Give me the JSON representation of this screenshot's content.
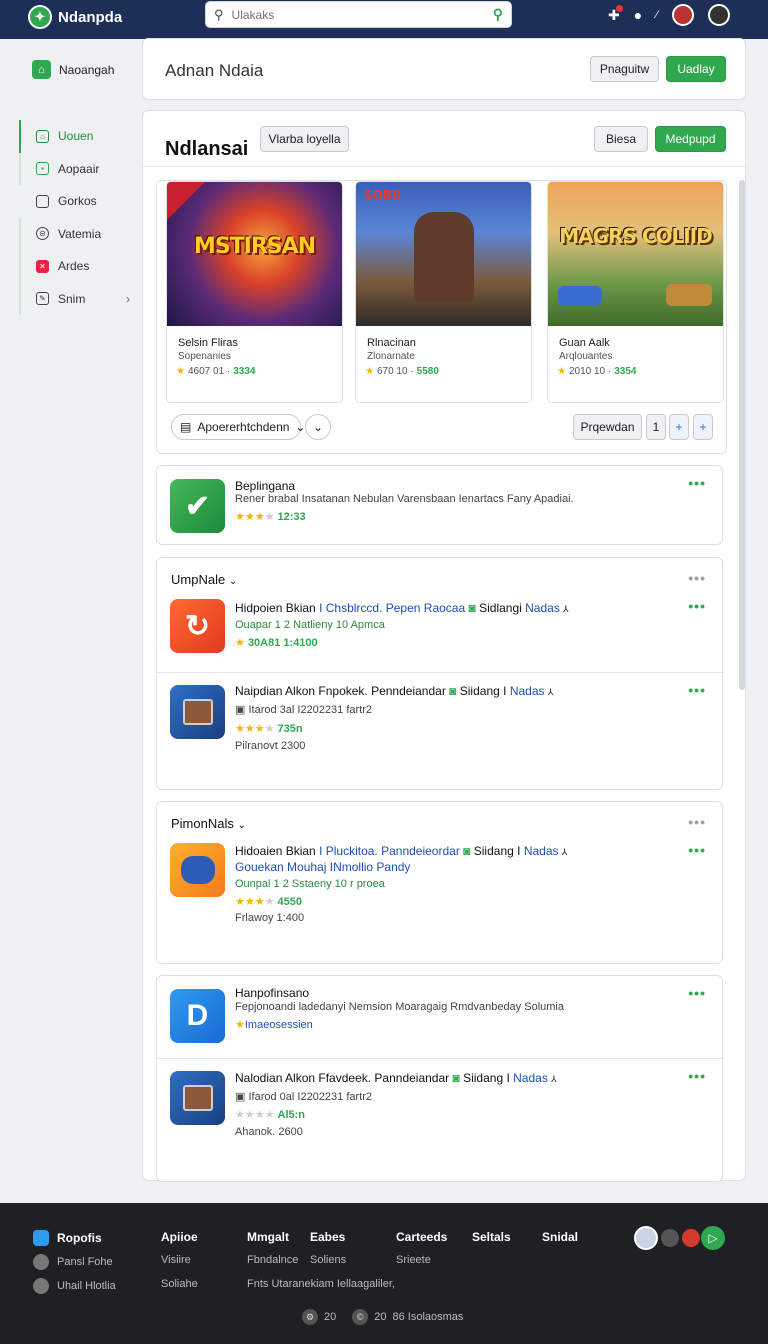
{
  "topbar": {
    "brand": "Ndanpda",
    "search_placeholder": "Ulakaks"
  },
  "sidebar": {
    "brand": "Naoangah",
    "items": [
      {
        "label": "Uouen",
        "icon": "home-icon"
      },
      {
        "label": "Aopaair",
        "icon": "grid-icon"
      },
      {
        "label": "Gorkos",
        "icon": "square-icon"
      },
      {
        "label": "Vatemia",
        "icon": "circle-icon"
      },
      {
        "label": "Ardes",
        "icon": "flag-icon"
      },
      {
        "label": "Snim",
        "icon": "edit-icon"
      }
    ]
  },
  "header": {
    "title": "Adnan Ndaia",
    "btn_secondary": "Pnaguitw",
    "btn_primary": "Uadlay"
  },
  "main": {
    "title": "Ndlansai",
    "filter": "Vlarba loyella",
    "btn_secondary": "Biesa",
    "btn_primary": "Medpupd",
    "games": [
      {
        "art_text": "MSTIRSAN",
        "corner": "",
        "name": "Selsin Fliras",
        "sub": "Sopenanies",
        "rating": "4607 01 ·",
        "value": "3334",
        "stars": 1
      },
      {
        "art_text": "",
        "corner": "SOBIl",
        "name": "Rlnacinan",
        "sub": "Zlonarnate",
        "rating": "670 10 ·",
        "value": "5580",
        "stars": 1
      },
      {
        "art_text": "MAGRS COLIID",
        "corner": "",
        "name": "Guan Aalk",
        "sub": "Arqlouantes",
        "rating": "2010 10 ·",
        "value": "3354",
        "stars": 1
      }
    ],
    "sort_label": "Apoererhtchdenn",
    "page_label": "Prqewdan",
    "page_number": "1",
    "page_plus": "+",
    "page_next": "+"
  },
  "featured": {
    "title": "Beplingana",
    "desc": "Rener brabal Insatanan Nebulan Varensbaan Ienartacs Fany Apadiai.",
    "value": "12:33",
    "stars": 3
  },
  "section1": {
    "title": "UmpNale",
    "items": [
      {
        "title": "Hidpoien Bkian",
        "link": "I Chsblrccd. Pepen Raocaa",
        "tag": "Sidlangi",
        "tag2": "Nadas",
        "line1": "Ouapar 1 2 Natlieny 10 Apmca",
        "rating_value": "30A81 1:4100",
        "extra": ""
      },
      {
        "title": "Naipdian Alkon Fnpokek. Penndeiandar",
        "link": "",
        "tag": "Siidang I",
        "tag2": "Nadas",
        "line1": "Itarod 3al I2202231 fartr2",
        "rating_value": "735n",
        "extra": "Pilranovt 2300"
      }
    ]
  },
  "section2": {
    "title": "PimonNals",
    "items": [
      {
        "title": "Hidoaien Bkian",
        "link": "I Pluckitoa. Panndeieordar",
        "tag": "Siidang I",
        "tag2": "Nadas",
        "line_blue": "Gouekan Mouhaj INmollio Pandy",
        "line1": "Ounpal 1 2 Sstaeny 10 r proea",
        "rating_value": "4550",
        "extra": "Frlawoy 1:400"
      }
    ]
  },
  "section3": {
    "items": [
      {
        "title": "Hanpofinsano",
        "desc": "Fepjonoandi ladedanyi Nemsion Moaragaig Rmdvanbeday Solumia",
        "value": "Imaeosessien"
      },
      {
        "title": "Nalodian Alkon Ffavdeek. Panndeiandar",
        "tag": "Siidang I",
        "tag2": "Nadas",
        "line1": "Ifarod 0al I2202231 fartr2",
        "rating_value": "Al5:n",
        "extra": "Ahanok. 2600"
      }
    ]
  },
  "footer": {
    "brand": "Ropofis",
    "col1": [
      "Pansl Fohe",
      "Uhail Hlotlia"
    ],
    "headers": [
      "Apiioe",
      "Mmgalt",
      "Eabes",
      "Carteeds",
      "Seltals",
      "Snidal"
    ],
    "links": {
      "apiioe": [
        "Visiire",
        "Soliahe"
      ],
      "mmgalt": [
        "Fbndalnce",
        "Fnts Utaranekiam Iellaagaliler,"
      ],
      "eabes": [
        "Soliens"
      ],
      "carteeds": [
        "Srieete"
      ]
    },
    "bottom": [
      "20",
      "20",
      "86 Isolaosmas"
    ]
  }
}
